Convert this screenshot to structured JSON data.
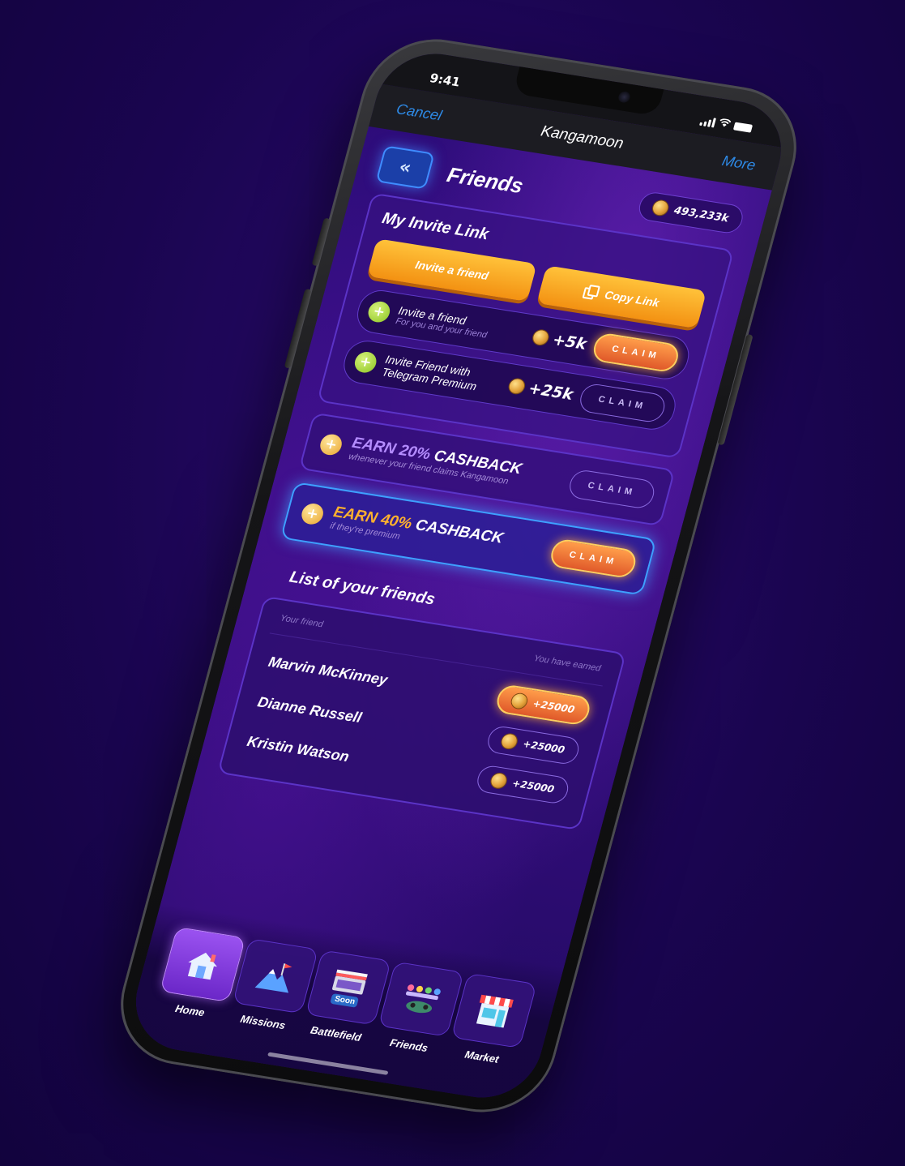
{
  "status": {
    "time": "9:41"
  },
  "header": {
    "cancel": "Cancel",
    "title": "Kangamoon",
    "more": "More"
  },
  "page": {
    "title": "Friends",
    "balance": "493,233k"
  },
  "invite": {
    "heading": "My Invite Link",
    "invite_button": "Invite a friend",
    "copy_button": "Copy Link",
    "tasks": [
      {
        "title": "Invite a friend",
        "subtitle": "For you and your friend",
        "reward": "+5k",
        "claim": "CLAIM",
        "state": "active"
      },
      {
        "title": "Invite Friend with Telegram Premium",
        "subtitle": "",
        "reward": "+25k",
        "claim": "CLAIM",
        "state": "outline"
      }
    ]
  },
  "cashback": [
    {
      "prefix": "EARN 20%",
      "suffix": " CASHBACK",
      "subtitle": "whenever your friend claims Kangamoon",
      "claim": "CLAIM",
      "state": "outline"
    },
    {
      "prefix": "EARN 40%",
      "suffix": " CASHBACK",
      "subtitle": "if they're premium",
      "claim": "CLAIM",
      "state": "active"
    }
  ],
  "friends": {
    "heading": "List of your friends",
    "col_friend": "Your friend",
    "col_earned": "You have earned",
    "rows": [
      {
        "name": "Marvin McKinney",
        "earned": "+25000",
        "top": true
      },
      {
        "name": "Dianne Russell",
        "earned": "+25000",
        "top": false
      },
      {
        "name": "Kristin Watson",
        "earned": "+25000",
        "top": false
      }
    ]
  },
  "tabs": [
    {
      "label": "Home",
      "icon": "home-icon",
      "active": true
    },
    {
      "label": "Missions",
      "icon": "mountain-flag-icon",
      "active": false
    },
    {
      "label": "Battlefield",
      "icon": "arena-icon",
      "active": false,
      "badge": "Soon"
    },
    {
      "label": "Friends",
      "icon": "friends-group-icon",
      "active": false
    },
    {
      "label": "Market",
      "icon": "shop-icon",
      "active": false
    }
  ],
  "colors": {
    "accent_orange": "#f39112",
    "accent_blue": "#3ea0ff",
    "bg_purple": "#2b0c78"
  }
}
